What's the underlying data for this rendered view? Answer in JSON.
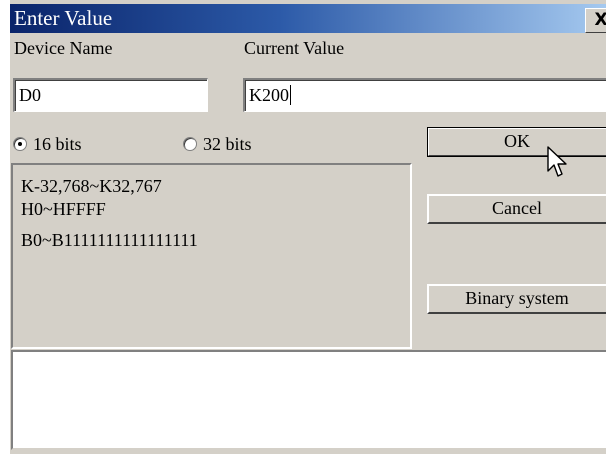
{
  "window": {
    "title": "Enter Value",
    "close_glyph": "X"
  },
  "labels": {
    "device_name": "Device Name",
    "current_value": "Current Value"
  },
  "inputs": {
    "device_name_value": "D0",
    "current_value_value": "K200"
  },
  "bit_mode": {
    "options": [
      {
        "label": "16 bits",
        "selected": true
      },
      {
        "label": "32 bits",
        "selected": false
      }
    ]
  },
  "ranges": [
    "K-32,768~K32,767",
    "H0~HFFFF",
    "B0~B1111111111111111"
  ],
  "buttons": {
    "ok": "OK",
    "cancel": "Cancel",
    "binary": "Binary system"
  },
  "output": {
    "text": ""
  }
}
